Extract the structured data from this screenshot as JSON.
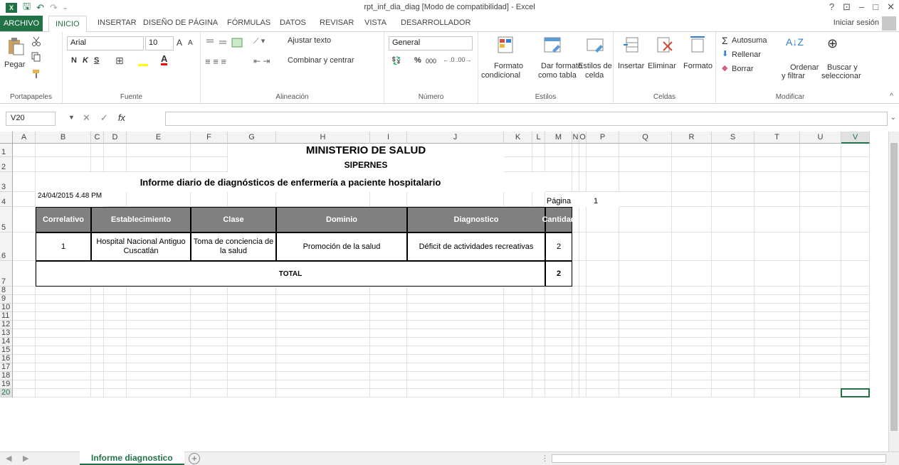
{
  "window": {
    "title": "rpt_inf_dia_diag  [Modo de compatibilidad] - Excel",
    "help": "?",
    "ribbon_display": "⊡",
    "minimize": "–",
    "maximize": "□",
    "close": "✕"
  },
  "qat": {
    "save": "🖫",
    "undo": "↶",
    "redo": "↷",
    "customize": "⩦"
  },
  "tabs": {
    "file": "ARCHIVO",
    "items": [
      "INICIO",
      "INSERTAR",
      "DISEÑO DE PÁGINA",
      "FÓRMULAS",
      "DATOS",
      "REVISAR",
      "VISTA",
      "DESARROLLADOR"
    ],
    "active": "INICIO",
    "signin": "Iniciar sesión"
  },
  "ribbon": {
    "clipboard": {
      "paste": "Pegar",
      "label": "Portapapeles"
    },
    "font": {
      "name": "Arial",
      "size": "10",
      "bold": "N",
      "italic": "K",
      "underline": "S",
      "label": "Fuente"
    },
    "alignment": {
      "wrap": "Ajustar texto",
      "merge": "Combinar y centrar",
      "label": "Alineación"
    },
    "number": {
      "format": "General",
      "percent": "%",
      "thousands": "000",
      "label": "Número"
    },
    "styles": {
      "conditional": [
        "Formato",
        "condicional"
      ],
      "as_table": [
        "Dar formato",
        "como tabla"
      ],
      "cell_styles": [
        "Estilos de",
        "celda"
      ],
      "label": "Estilos"
    },
    "cells": {
      "insert": "Insertar",
      "delete": "Eliminar",
      "format": "Formato",
      "label": "Celdas"
    },
    "editing": {
      "autosum": "Autosuma",
      "fill": "Rellenar",
      "clear": "Borrar",
      "sort": [
        "Ordenar",
        "y filtrar"
      ],
      "find": [
        "Buscar y",
        "seleccionar"
      ],
      "label": "Modificar"
    }
  },
  "formula_bar": {
    "name_box": "V20",
    "cancel": "✕",
    "enter": "✓",
    "fx": "fx",
    "value": ""
  },
  "columns": [
    "A",
    "B",
    "C",
    "D",
    "E",
    "F",
    "G",
    "H",
    "I",
    "J",
    "K",
    "L",
    "M",
    "N",
    "O",
    "P",
    "Q",
    "R",
    "S",
    "T",
    "U",
    "V"
  ],
  "rows": [
    "1",
    "2",
    "3",
    "4",
    "5",
    "6",
    "7",
    "8",
    "9",
    "10",
    "11",
    "12",
    "13",
    "14",
    "15",
    "16",
    "17",
    "18",
    "19",
    "20"
  ],
  "selected_cell": {
    "column": "V",
    "row": "20"
  },
  "report": {
    "title": "MINISTERIO DE SALUD",
    "subtitle": "SIPERNES",
    "heading": "Informe diario de diagnósticos de enfermería a paciente hospitalario",
    "datetime": "24/04/2015 4.48 PM",
    "page_label": "Página",
    "page_number": "1",
    "headers": [
      "Correlativo",
      "Establecimiento",
      "Clase",
      "Dominio",
      "Diagnostico",
      "Cantidad"
    ],
    "row": {
      "correlativo": "1",
      "establecimiento": "Hospital Nacional Antiguo Cuscatlán",
      "clase": "Toma de conciencia de la salud",
      "dominio": "Promoción de la  salud",
      "diagnostico": "Déficit de actividades recreativas",
      "cantidad": "2"
    },
    "total_label": "TOTAL",
    "total_value": "2"
  },
  "sheet_tabs": {
    "active": "Informe diagnostico",
    "add": "+",
    "prev": "◀",
    "next": "▶"
  }
}
